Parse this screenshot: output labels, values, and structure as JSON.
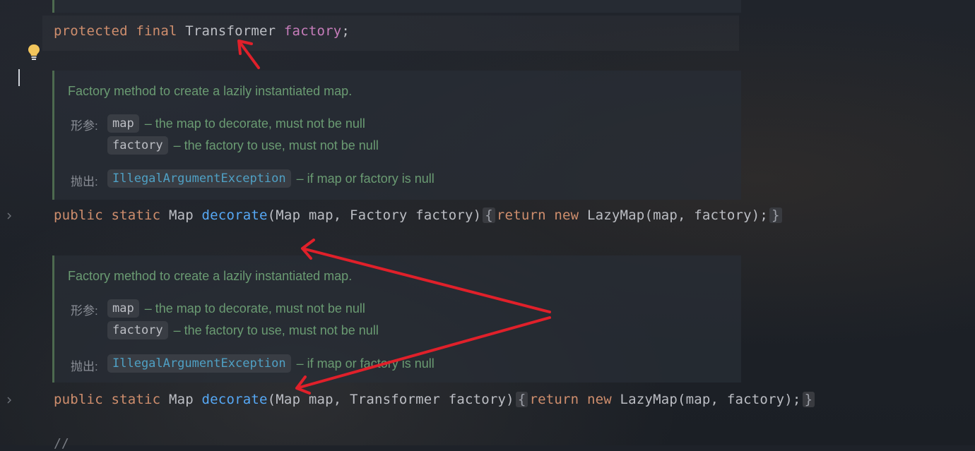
{
  "editor": {
    "field_line": {
      "kw1": "protected",
      "kw2": "final",
      "type": "Transformer",
      "name": "factory",
      "end": ";"
    },
    "methods": [
      {
        "doc": {
          "description": "Factory method to create a lazily instantiated map.",
          "params_label": "形参:",
          "params": [
            {
              "name": "map",
              "text": "– the map to decorate, must not be null"
            },
            {
              "name": "factory",
              "text": "– the factory to use, must not be null"
            }
          ],
          "throws_label": "抛出:",
          "throws": {
            "name": "IllegalArgumentException",
            "text": "– if map or factory is null"
          }
        },
        "sig": {
          "kw1": "public",
          "kw2": "static",
          "ret": "Map",
          "fn": "decorate",
          "params": "(Map map, Factory factory)",
          "open": "{",
          "kw3": "return",
          "kw4": "new",
          "body": "LazyMap(map, factory);",
          "close": "}"
        }
      },
      {
        "doc": {
          "description": "Factory method to create a lazily instantiated map.",
          "params_label": "形参:",
          "params": [
            {
              "name": "map",
              "text": "– the map to decorate, must not be null"
            },
            {
              "name": "factory",
              "text": "– the factory to use, must not be null"
            }
          ],
          "throws_label": "抛出:",
          "throws": {
            "name": "IllegalArgumentException",
            "text": "– if map or factory is null"
          }
        },
        "sig": {
          "kw1": "public",
          "kw2": "static",
          "ret": "Map",
          "fn": "decorate",
          "params": "(Map map, Transformer factory)",
          "open": "{",
          "kw3": "return",
          "kw4": "new",
          "body": "LazyMap(map, factory);",
          "close": "}"
        }
      }
    ],
    "bottom_fragment": "//"
  },
  "colors": {
    "keyword": "#cf8e6d",
    "function": "#56a8f5",
    "field": "#c77dbb",
    "doc_text": "#6a9b72",
    "annotation_arrow": "#e0202a"
  },
  "icons": {
    "gutter_hint": "lightbulb-icon",
    "fold": "chevron-right-icon"
  }
}
